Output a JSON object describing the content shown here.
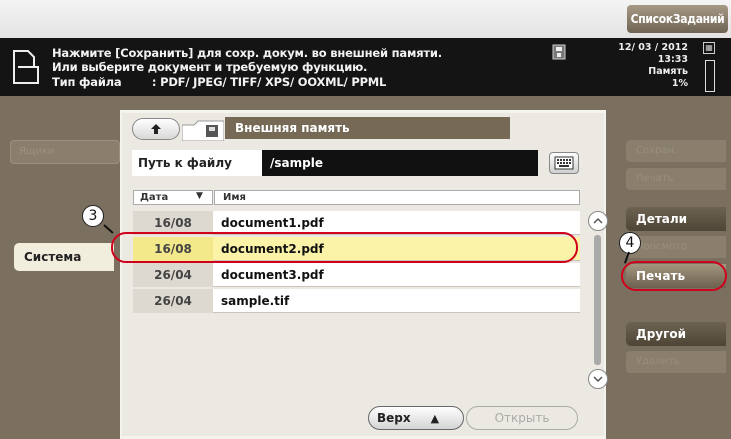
{
  "header": {
    "job_list_label": "СписокЗаданий"
  },
  "message": {
    "line1": "Нажмите [Сохранить] для сохр. докум. во внешней памяти.",
    "line2": "Или выберите документ и требуемую функцию.",
    "line3": "Тип файла        : PDF/ JPEG/ TIFF/ XPS/ OOXML/ PPML",
    "date": "12/ 03 / 2012",
    "time": "13:33",
    "memory_label": "Память",
    "memory_percent": "1%"
  },
  "left": {
    "dim_tab": "Ящики",
    "system_tab": "Система"
  },
  "panel": {
    "location_label": "Внешняя память",
    "path_label": "Путь к файлу",
    "path_value": "/sample",
    "col_date": "Дата",
    "col_name": "Имя",
    "files": [
      {
        "date": "16/08",
        "name": "document1.pdf",
        "selected": false
      },
      {
        "date": "16/08",
        "name": "document2.pdf",
        "selected": true
      },
      {
        "date": "26/04",
        "name": "document3.pdf",
        "selected": false
      },
      {
        "date": "26/04",
        "name": "sample.tif",
        "selected": false
      }
    ],
    "top_button": "Верх",
    "open_button": "Открыть"
  },
  "right": {
    "dim1": "Сохран.",
    "dim2": "Печать",
    "details": "Детали",
    "dim3": "Просмотр",
    "print": "Печать",
    "other": "Другой",
    "dim4": "Удалить"
  },
  "callouts": {
    "c3": "3",
    "c4": "4"
  }
}
